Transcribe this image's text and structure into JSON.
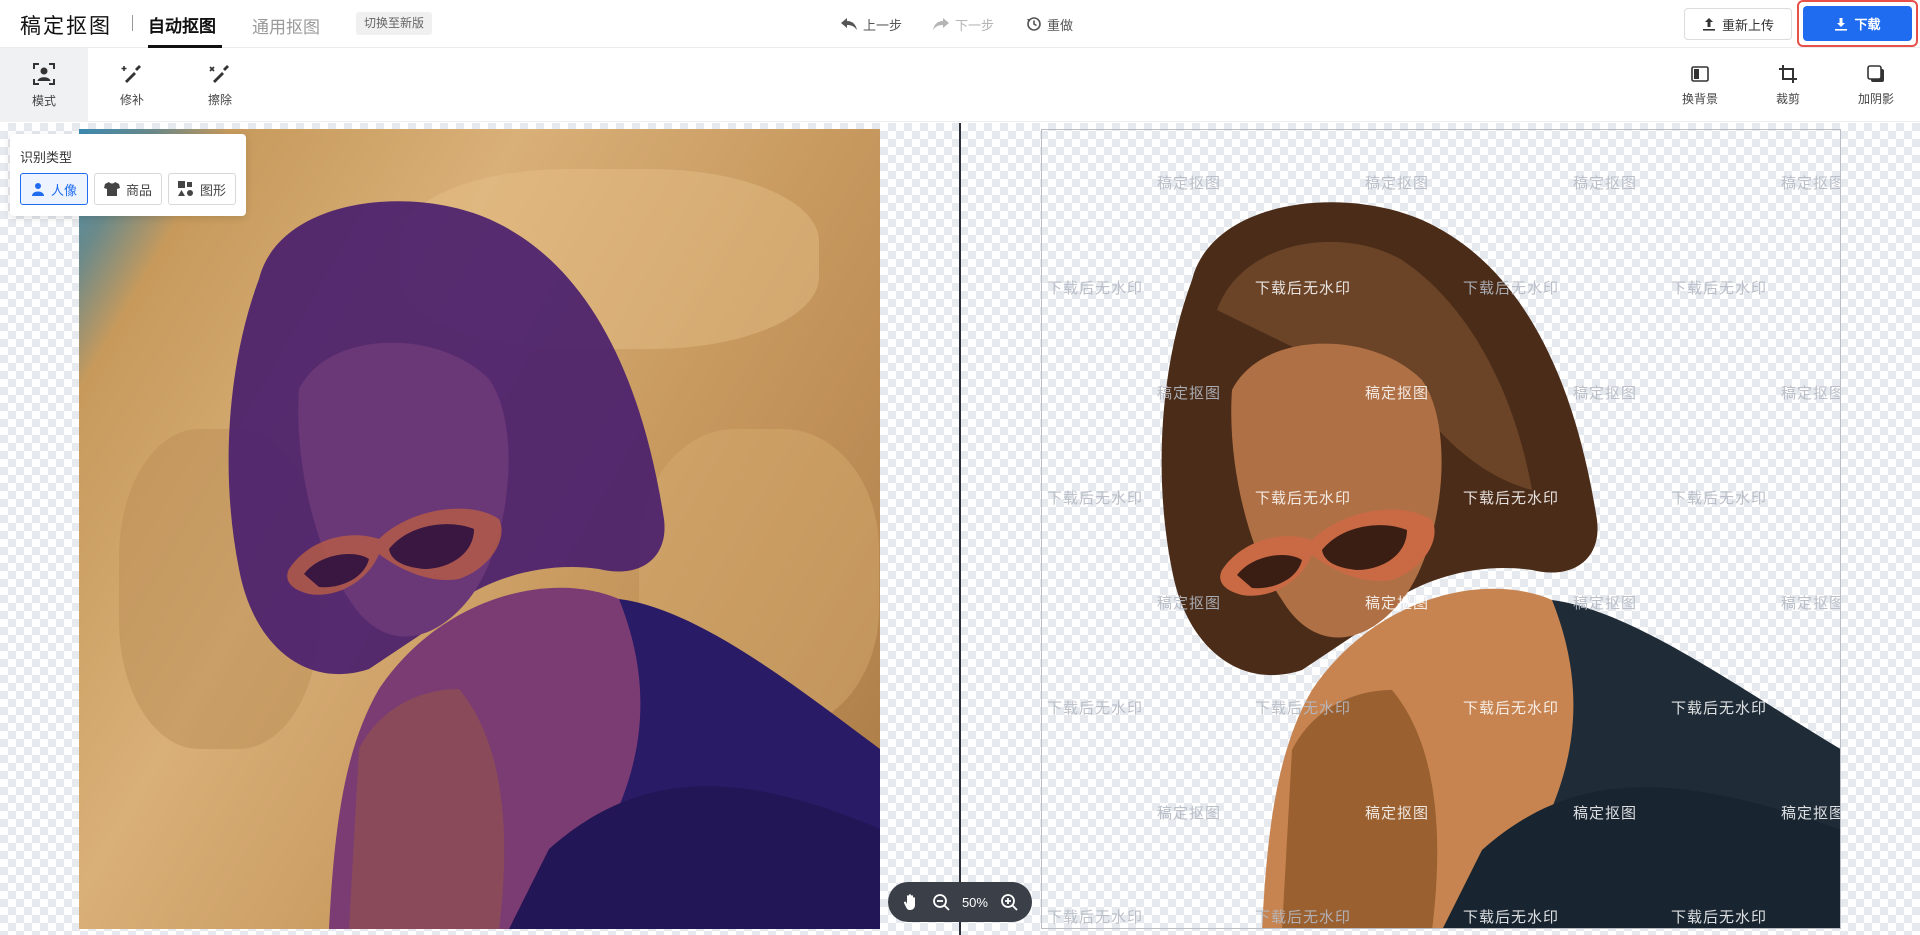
{
  "header": {
    "logo": "稿定抠图",
    "tab_active": "自动抠图",
    "tab_inactive": "通用抠图",
    "switch_label": "切换至新版",
    "undo_label": "上一步",
    "redo_label": "下一步",
    "reset_label": "重做",
    "reupload_label": "重新上传",
    "download_label": "下载"
  },
  "toolbar": {
    "left_tools": [
      {
        "label": "模式",
        "icon": "person-frame-icon"
      },
      {
        "label": "修补",
        "icon": "brush-plus-icon"
      },
      {
        "label": "擦除",
        "icon": "brush-minus-icon"
      }
    ],
    "right_tools": [
      {
        "label": "换背景",
        "icon": "background-icon"
      },
      {
        "label": "裁剪",
        "icon": "crop-icon"
      },
      {
        "label": "加阴影",
        "icon": "shadow-icon"
      }
    ]
  },
  "recognition": {
    "title": "识别类型",
    "options": [
      {
        "label": "人像",
        "icon": "person-icon",
        "active": true
      },
      {
        "label": "商品",
        "icon": "shirt-icon",
        "active": false
      },
      {
        "label": "图形",
        "icon": "shapes-icon",
        "active": false
      }
    ]
  },
  "watermark": {
    "brand": "稿定抠图",
    "notice": "下载后无水印"
  },
  "zoom": {
    "level": "50%"
  },
  "colors": {
    "accent": "#1f6cf0",
    "highlight_outline": "#e8504a"
  }
}
